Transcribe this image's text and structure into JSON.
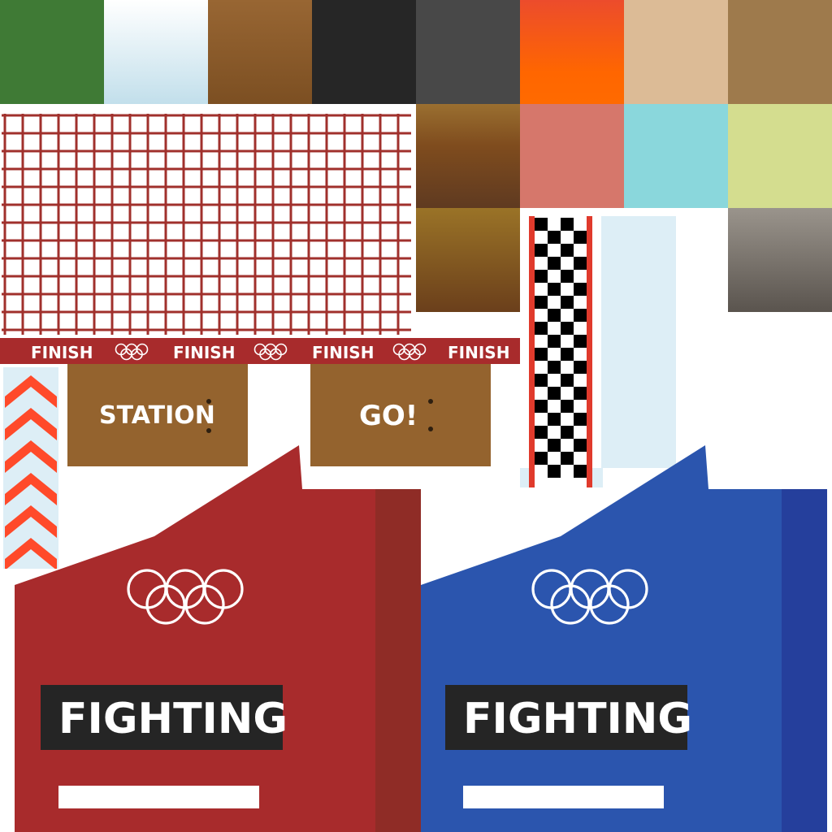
{
  "texture_atlas": {
    "banner": {
      "labels": [
        "FINISH",
        "FINISH",
        "FINISH",
        "FINISH"
      ],
      "color": "#a82b2c",
      "rings_icon": "olympic-rings-icon"
    },
    "signs": {
      "station_label": "STATION",
      "go_label": "GO!",
      "color": "#94632e"
    },
    "panels": {
      "red": {
        "label": "FIGHTING",
        "color": "#a82b2c",
        "side_color": "#8f2c26",
        "emblem": "olympic-rings-icon"
      },
      "blue": {
        "label": "FIGHTING",
        "color": "#2b55ae",
        "side_color": "#253f9c",
        "emblem": "olympic-rings-icon"
      }
    },
    "swatch_colors": [
      "#3f7a35",
      "#c9e3ed",
      "#8a5a2a",
      "#262626",
      "#484848",
      "#ff6a00",
      "#dcbb96",
      "#9e7a4c",
      "#d6776b",
      "#8ad7dc",
      "#d4dd8f"
    ],
    "net_color": "#a0302c",
    "chevron_color": "#ff4a2a",
    "checker_colors": [
      "#000000",
      "#ffffff",
      "#e03a2c"
    ]
  }
}
